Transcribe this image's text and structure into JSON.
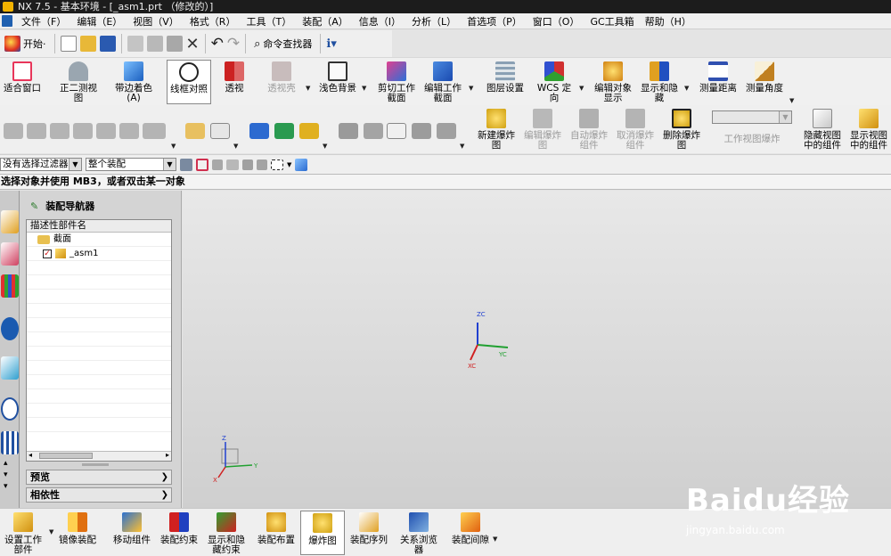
{
  "window": {
    "title": "NX 7.5 - 基本环境 - [_asm1.prt （修改的）]"
  },
  "menu": [
    "文件（F）",
    "编辑（E）",
    "视图（V）",
    "格式（R）",
    "工具（T）",
    "装配（A）",
    "信息（I）",
    "分析（L）",
    "首选项（P）",
    "窗口（O）",
    "GC工具箱",
    "帮助（H）"
  ],
  "std": {
    "start": "开始·",
    "cmd_finder": "命令查找器"
  },
  "toolbar": [
    {
      "label": "适合窗口",
      "icon": "fit-window-icon",
      "color": "#e8365a"
    },
    {
      "label": "正二测视\n图",
      "icon": "trimetric-view-icon",
      "color": "#7a8a9a"
    },
    {
      "label": "带边着色\n(A)",
      "icon": "shaded-with-edges-icon",
      "color": "#2b7fd4"
    },
    {
      "label": "线框对照",
      "icon": "wireframe-compare-icon",
      "color": "#333333"
    },
    {
      "label": "透视",
      "icon": "perspective-icon",
      "color": "#d02040"
    },
    {
      "label": "透视壳",
      "icon": "perspective-shell-icon",
      "color": "#b0a8a8"
    },
    {
      "label": "浅色背景",
      "icon": "light-background-icon",
      "color": "#444444"
    },
    {
      "label": "剪切工作\n截面",
      "icon": "clip-section-icon",
      "color": "#c01060"
    },
    {
      "label": "编辑工作\n截面",
      "icon": "edit-section-icon",
      "color": "#2060d0"
    },
    {
      "label": "图层设置",
      "icon": "layer-settings-icon",
      "color": "#7a8a9a"
    },
    {
      "label": "WCS 定向",
      "icon": "wcs-orient-icon",
      "color": "#d03030"
    },
    {
      "label": "编辑对象\n显示",
      "icon": "edit-object-display-icon",
      "color": "#e0a020"
    },
    {
      "label": "显示和隐\n藏",
      "icon": "show-hide-icon",
      "color": "#2060c0"
    },
    {
      "label": "测量距离",
      "icon": "measure-distance-icon",
      "color": "#3050b0"
    },
    {
      "label": "测量角度",
      "icon": "measure-angle-icon",
      "color": "#c08020"
    }
  ],
  "exploded": [
    {
      "label": "新建爆炸\n图",
      "icon": "new-explosion-icon"
    },
    {
      "label": "编辑爆炸\n图",
      "icon": "edit-explosion-icon"
    },
    {
      "label": "自动爆炸\n组件",
      "icon": "auto-explode-icon"
    },
    {
      "label": "取消爆炸\n组件",
      "icon": "unexplode-icon"
    },
    {
      "label": "删除爆炸\n图",
      "icon": "delete-explosion-icon"
    },
    {
      "label": "工作视图爆炸",
      "icon": "work-view-explosion-icon"
    },
    {
      "label": "隐藏视图\n中的组件",
      "icon": "hide-view-component-icon"
    },
    {
      "label": "显示视图\n中的组件",
      "icon": "show-view-component-icon"
    }
  ],
  "selection": {
    "filter": "没有选择过滤器",
    "scope": "整个装配"
  },
  "cue": "选择对象并使用 MB3，或者双击某一对象",
  "navigator": {
    "title": "装配导航器",
    "column": "描述性部件名",
    "rows": [
      {
        "label": "截面"
      },
      {
        "label": "_asm1"
      }
    ],
    "panels": [
      "预览",
      "相依性"
    ]
  },
  "triad": {
    "zc": "ZC",
    "yc": "YC",
    "xc": "XC",
    "z": "Z",
    "y": "Y",
    "x": "X"
  },
  "bottom": [
    {
      "label": "设置工作\n部件",
      "icon": "set-work-part-icon"
    },
    {
      "label": "镜像装配",
      "icon": "mirror-assembly-icon"
    },
    {
      "label": "移动组件",
      "icon": "move-component-icon"
    },
    {
      "label": "装配约束",
      "icon": "assembly-constraint-icon"
    },
    {
      "label": "显示和隐\n藏约束",
      "icon": "show-hide-constraint-icon"
    },
    {
      "label": "装配布置",
      "icon": "assembly-arrangement-icon"
    },
    {
      "label": "爆炸图",
      "icon": "exploded-view-icon"
    },
    {
      "label": "装配序列",
      "icon": "assembly-sequence-icon"
    },
    {
      "label": "关系浏览\n器",
      "icon": "relation-browser-icon"
    },
    {
      "label": "装配间隙",
      "icon": "assembly-clearance-icon"
    }
  ],
  "watermark": {
    "brand": "Baidu经验",
    "url": "jingyan.baidu.com"
  }
}
